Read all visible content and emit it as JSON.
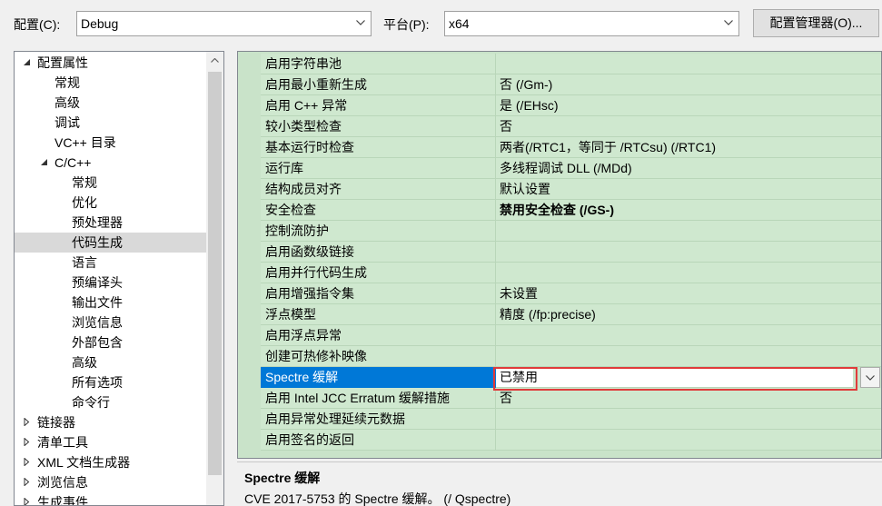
{
  "toolbar": {
    "config_label": "配置(C):",
    "config_value": "Debug",
    "platform_label": "平台(P):",
    "platform_value": "x64",
    "config_manager_button": "配置管理器(O)..."
  },
  "tree": {
    "items": [
      {
        "label": "配置属性",
        "twisty": "expanded"
      },
      {
        "label": "常规"
      },
      {
        "label": "高级"
      },
      {
        "label": "调试"
      },
      {
        "label": "VC++ 目录"
      },
      {
        "label": "C/C++",
        "twisty": "expanded"
      },
      {
        "label": "常规"
      },
      {
        "label": "优化"
      },
      {
        "label": "预处理器"
      },
      {
        "label": "代码生成",
        "selected": true
      },
      {
        "label": "语言"
      },
      {
        "label": "预编译头"
      },
      {
        "label": "输出文件"
      },
      {
        "label": "浏览信息"
      },
      {
        "label": "外部包含"
      },
      {
        "label": "高级"
      },
      {
        "label": "所有选项"
      },
      {
        "label": "命令行"
      },
      {
        "label": "链接器",
        "twisty": "collapsed"
      },
      {
        "label": "清单工具",
        "twisty": "collapsed"
      },
      {
        "label": "XML 文档生成器",
        "twisty": "collapsed"
      },
      {
        "label": "浏览信息",
        "twisty": "collapsed"
      },
      {
        "label": "生成事件",
        "twisty": "collapsed"
      }
    ]
  },
  "properties": [
    {
      "name": "启用字符串池",
      "value": ""
    },
    {
      "name": "启用最小重新生成",
      "value": "否 (/Gm-)"
    },
    {
      "name": "启用 C++ 异常",
      "value": "是 (/EHsc)"
    },
    {
      "name": "较小类型检查",
      "value": "否"
    },
    {
      "name": "基本运行时检查",
      "value": "两者(/RTC1，等同于 /RTCsu) (/RTC1)"
    },
    {
      "name": "运行库",
      "value": "多线程调试 DLL (/MDd)"
    },
    {
      "name": "结构成员对齐",
      "value": "默认设置"
    },
    {
      "name": "安全检查",
      "value": "禁用安全检查 (/GS-)",
      "bold": true
    },
    {
      "name": "控制流防护",
      "value": ""
    },
    {
      "name": "启用函数级链接",
      "value": ""
    },
    {
      "name": "启用并行代码生成",
      "value": ""
    },
    {
      "name": "启用增强指令集",
      "value": "未设置"
    },
    {
      "name": "浮点模型",
      "value": "精度 (/fp:precise)"
    },
    {
      "name": "启用浮点异常",
      "value": ""
    },
    {
      "name": "创建可热修补映像",
      "value": ""
    },
    {
      "name": "Spectre 缓解",
      "value": "已禁用",
      "selected": true
    },
    {
      "name": "启用 Intel JCC Erratum 缓解措施",
      "value": "否"
    },
    {
      "name": "启用异常处理延续元数据",
      "value": ""
    },
    {
      "name": "启用签名的返回",
      "value": ""
    }
  ],
  "description": {
    "title": "Spectre 缓解",
    "text": "CVE 2017-5753 的 Spectre 缓解。   (/ Qspectre)"
  }
}
